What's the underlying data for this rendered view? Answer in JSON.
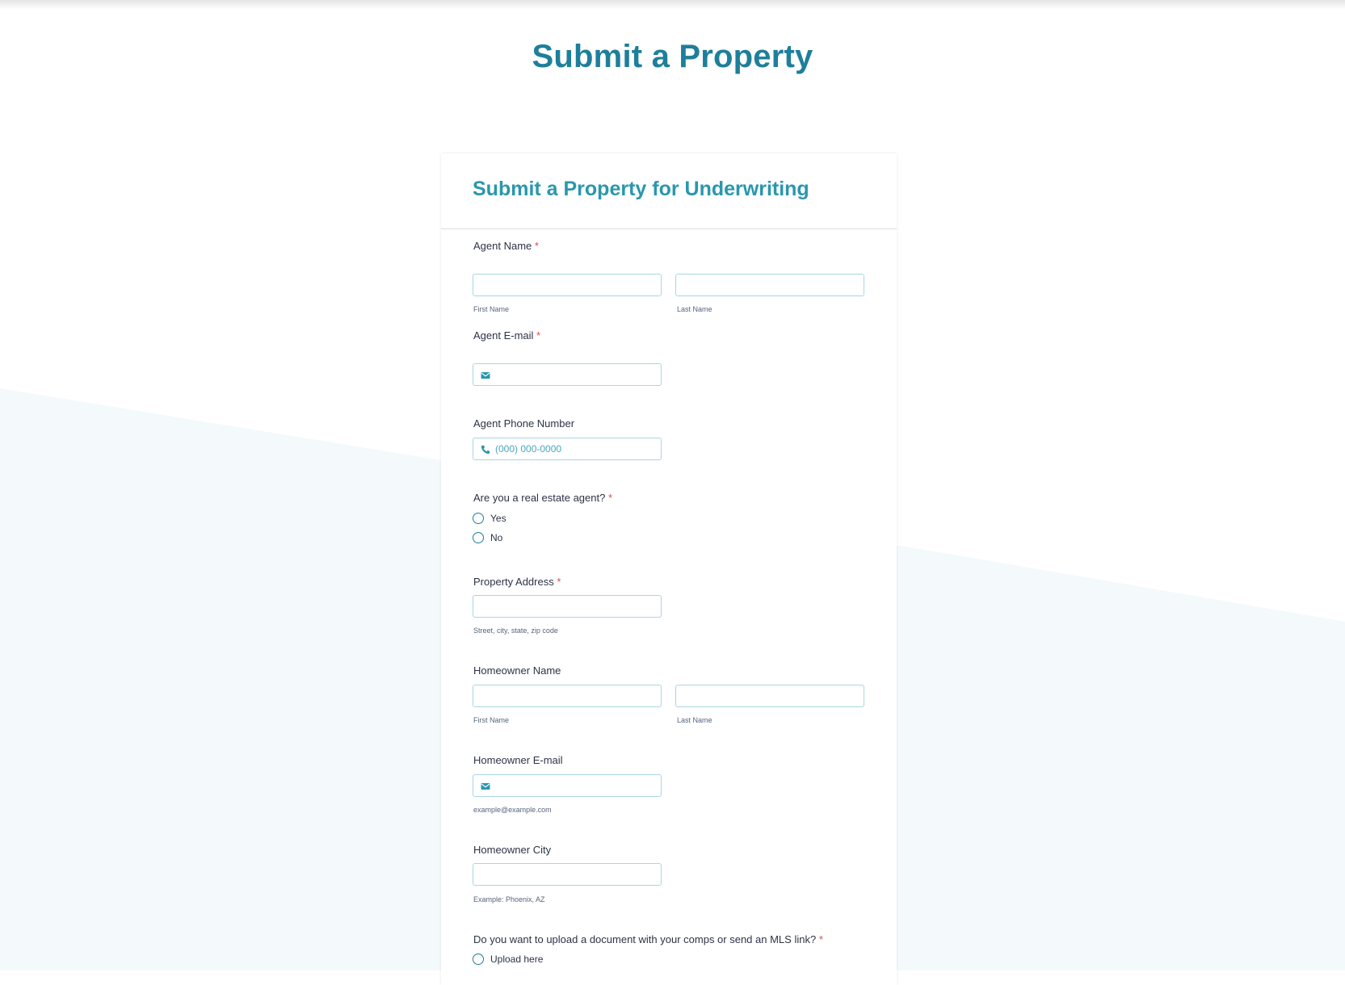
{
  "page": {
    "title": "Submit a Property"
  },
  "form": {
    "title": "Submit a Property for Underwriting",
    "required_mark": "*",
    "agent_name": {
      "label": "Agent Name",
      "first_sublabel": "First Name",
      "last_sublabel": "Last Name",
      "first_value": "",
      "last_value": ""
    },
    "agent_email": {
      "label": "Agent E-mail",
      "value": "",
      "icon": "envelope-icon"
    },
    "agent_phone": {
      "label": "Agent Phone Number",
      "placeholder": "(000) 000-0000",
      "icon": "phone-icon"
    },
    "is_agent": {
      "label": "Are you a real estate agent?",
      "options": [
        "Yes",
        "No"
      ],
      "selected": null
    },
    "property_address": {
      "label": "Property Address",
      "sublabel": "Street, city, state, zip code",
      "value": ""
    },
    "homeowner_name": {
      "label": "Homeowner Name",
      "first_sublabel": "First Name",
      "last_sublabel": "Last Name",
      "first_value": "",
      "last_value": ""
    },
    "homeowner_email": {
      "label": "Homeowner E-mail",
      "sublabel": "example@example.com",
      "value": "",
      "icon": "envelope-icon"
    },
    "homeowner_city": {
      "label": "Homeowner City",
      "sublabel": "Example: Phoenix, AZ",
      "value": ""
    },
    "comps_upload": {
      "label": "Do you want to upload a document with your comps or send an MLS link?",
      "options": [
        "Upload here"
      ],
      "selected": null
    }
  },
  "colors": {
    "title_primary": "#1e7f9a",
    "title_secondary": "#2a97ad",
    "input_border": "#a9d6e0",
    "required": "#e14b4b",
    "background_accent": "#f4f9fc"
  }
}
